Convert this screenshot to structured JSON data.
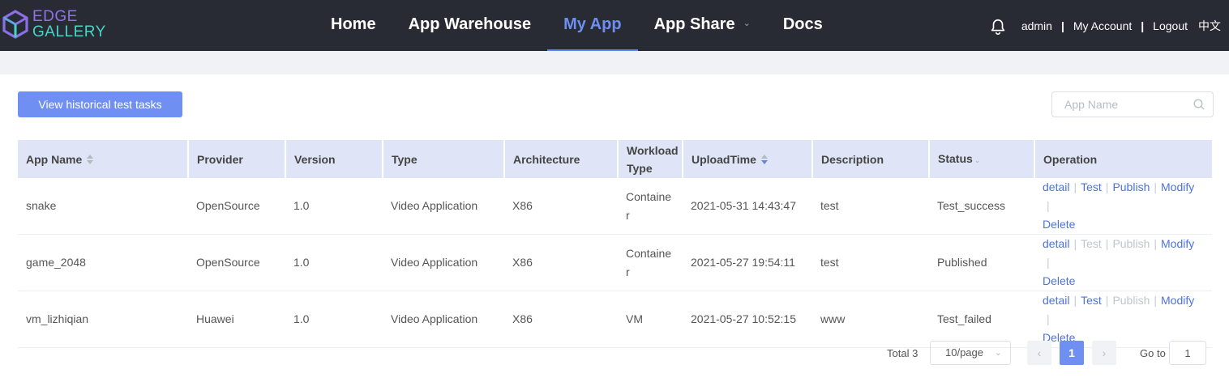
{
  "header": {
    "logo_line1": "EDGE",
    "logo_line2": "GALLERY",
    "nav": [
      {
        "label": "Home"
      },
      {
        "label": "App Warehouse"
      },
      {
        "label": "My App"
      },
      {
        "label": "App Share"
      },
      {
        "label": "Docs"
      }
    ],
    "active_nav": "My App",
    "user": "admin",
    "account_label": "My Account",
    "logout_label": "Logout",
    "language_label": "中文",
    "separator": "|"
  },
  "toolbar": {
    "history_button_label": "View historical test tasks",
    "search_placeholder": "App Name"
  },
  "table": {
    "columns": [
      {
        "label": "App Name"
      },
      {
        "label": "Provider"
      },
      {
        "label": "Version"
      },
      {
        "label": "Type"
      },
      {
        "label": "Architecture"
      },
      {
        "label": "Workload Type"
      },
      {
        "label": "UploadTime"
      },
      {
        "label": "Description"
      },
      {
        "label": "Status"
      },
      {
        "label": "Operation"
      }
    ],
    "rows": [
      {
        "app_name": "snake",
        "provider": "OpenSource",
        "version": "1.0",
        "type": "Video Application",
        "architecture": "X86",
        "workload_type": "Container",
        "upload_time": "2021-05-31 14:43:47",
        "description": "test",
        "status": "Test_success"
      },
      {
        "app_name": "game_2048",
        "provider": "OpenSource",
        "version": "1.0",
        "type": "Video Application",
        "architecture": "X86",
        "workload_type": "Container",
        "upload_time": "2021-05-27 19:54:11",
        "description": "test",
        "status": "Published"
      },
      {
        "app_name": "vm_lizhiqian",
        "provider": "Huawei",
        "version": "1.0",
        "type": "Video Application",
        "architecture": "X86",
        "workload_type": "VM",
        "upload_time": "2021-05-27 10:52:15",
        "description": "www",
        "status": "Test_failed"
      }
    ],
    "operations": {
      "detail": "detail",
      "test": "Test",
      "publish": "Publish",
      "modify": "Modify",
      "delete": "Delete"
    }
  },
  "pagination": {
    "total_label": "Total 3",
    "page_size": "10/page",
    "current_page": "1",
    "goto_label": "Go to",
    "goto_value": "1"
  },
  "colors": {
    "topbar": "#282b33",
    "accent": "#6f8ff2",
    "link": "#4c72e0",
    "disabled": "#c0c4cc",
    "header_row": "#dfe5f6"
  }
}
